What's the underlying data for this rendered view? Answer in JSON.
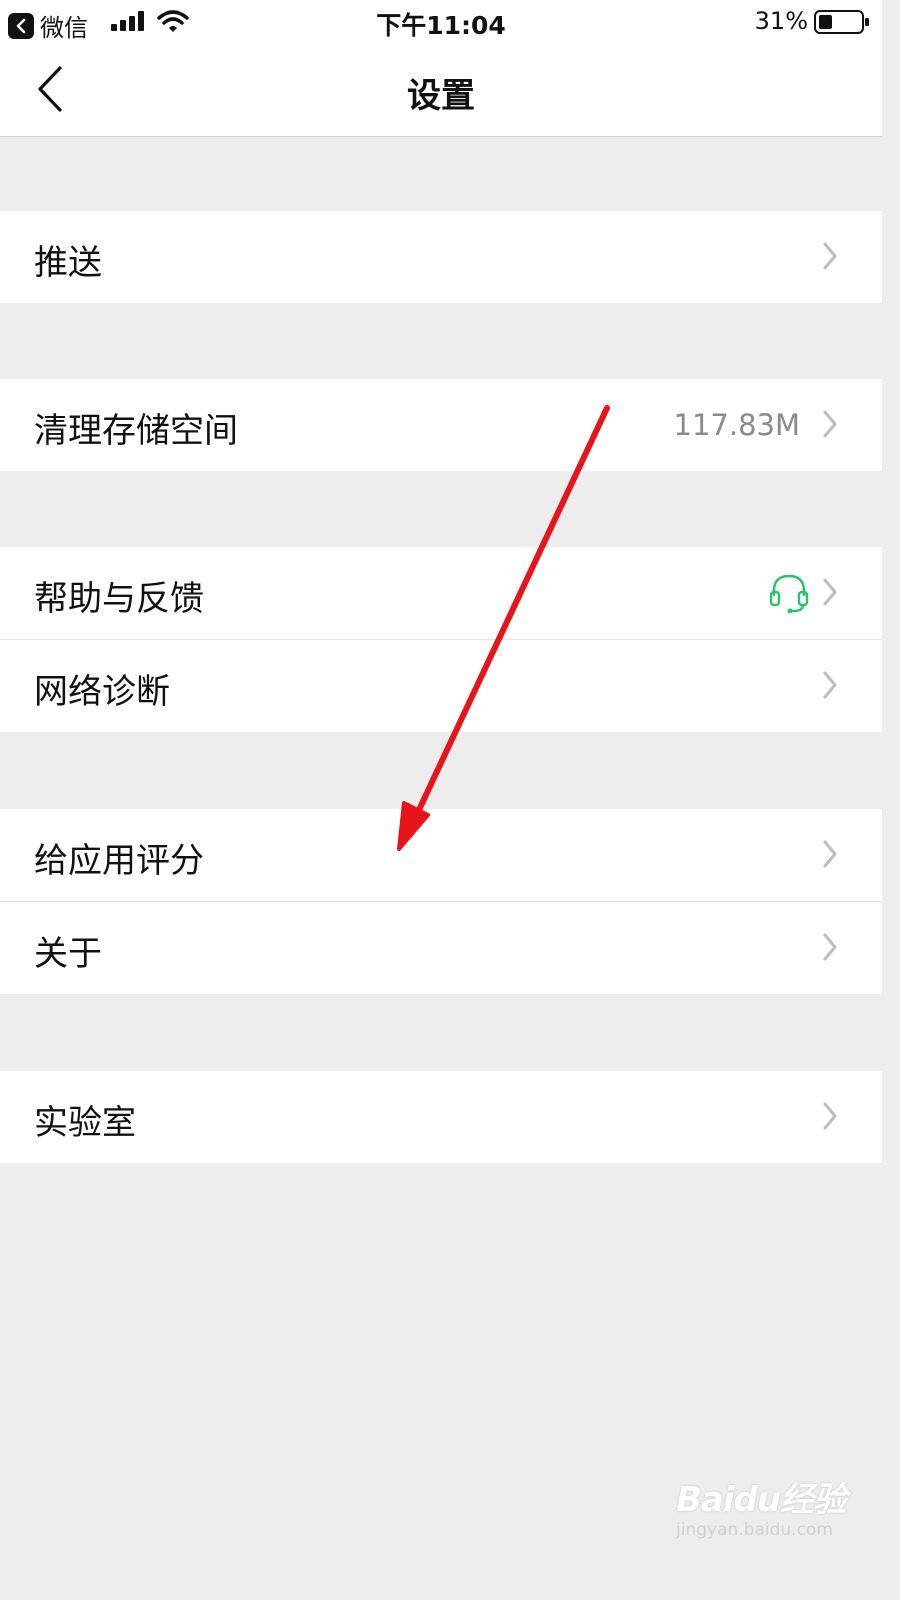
{
  "status_bar": {
    "app_name": "微信",
    "time": "下午11:04",
    "battery": "31%"
  },
  "nav": {
    "title": "设置"
  },
  "groups": [
    {
      "items": [
        {
          "label": "推送"
        }
      ]
    },
    {
      "items": [
        {
          "label": "清理存储空间",
          "value": "117.83M"
        }
      ]
    },
    {
      "items": [
        {
          "label": "帮助与反馈",
          "icon": "headset-icon"
        },
        {
          "label": "网络诊断"
        }
      ]
    },
    {
      "items": [
        {
          "label": "给应用评分"
        },
        {
          "label": "关于"
        }
      ]
    },
    {
      "items": [
        {
          "label": "实验室"
        }
      ]
    }
  ],
  "colors": {
    "accent_green": "#2bc26a",
    "annotation_red": "#e8141b"
  },
  "watermark": {
    "logo": "Baidu经验",
    "url": "jingyan.baidu.com"
  }
}
